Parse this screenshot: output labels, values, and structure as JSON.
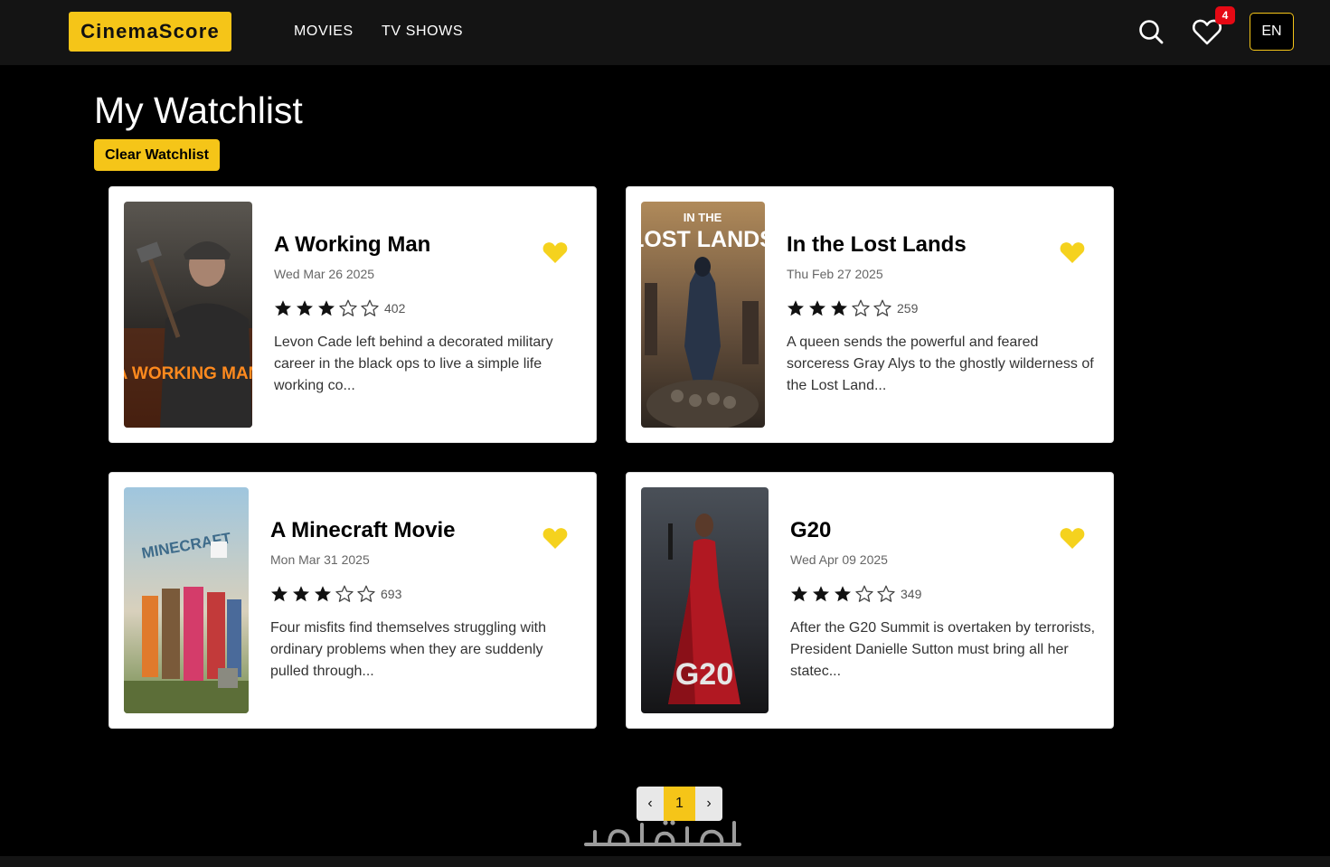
{
  "brand": {
    "name": "CinemaScore",
    "accent_color": "#f5c518"
  },
  "nav": [
    {
      "label": "MOVIES"
    },
    {
      "label": "TV SHOWS"
    }
  ],
  "header": {
    "search_icon": "search-icon",
    "favorites_icon": "heart-outline-icon",
    "favorites_count": "4",
    "language": "EN"
  },
  "page": {
    "title": "My Watchlist",
    "clear_label": "Clear Watchlist"
  },
  "movies": [
    {
      "title": "A Working Man",
      "date": "Wed Mar 26 2025",
      "rating_stars": 3,
      "max_stars": 5,
      "votes": "402",
      "overview": "Levon Cade left behind a decorated military career in the black ops to live a simple life working co...",
      "poster_text": "A WORKING MAN",
      "favorited": true
    },
    {
      "title": "In the Lost Lands",
      "date": "Thu Feb 27 2025",
      "rating_stars": 3,
      "max_stars": 5,
      "votes": "259",
      "overview": "A queen sends the powerful and feared sorceress Gray Alys to the ghostly wilderness of the Lost Land...",
      "poster_text": "IN THE LOST LANDS",
      "favorited": true
    },
    {
      "title": "A Minecraft Movie",
      "date": "Mon Mar 31 2025",
      "rating_stars": 3,
      "max_stars": 5,
      "votes": "693",
      "overview": "Four misfits find themselves struggling with ordinary problems when they are suddenly pulled through...",
      "poster_text": "MINECRAFT MOVIE",
      "favorited": true
    },
    {
      "title": "G20",
      "date": "Wed Apr 09 2025",
      "rating_stars": 3,
      "max_stars": 5,
      "votes": "349",
      "overview": "After the G20 Summit is overtaken by terrorists, President Danielle Sutton must bring all her statec...",
      "poster_text": "G20",
      "favorited": true
    }
  ],
  "pagination": {
    "prev": "‹",
    "current": "1",
    "next": "›"
  },
  "watermark": "خمسات"
}
